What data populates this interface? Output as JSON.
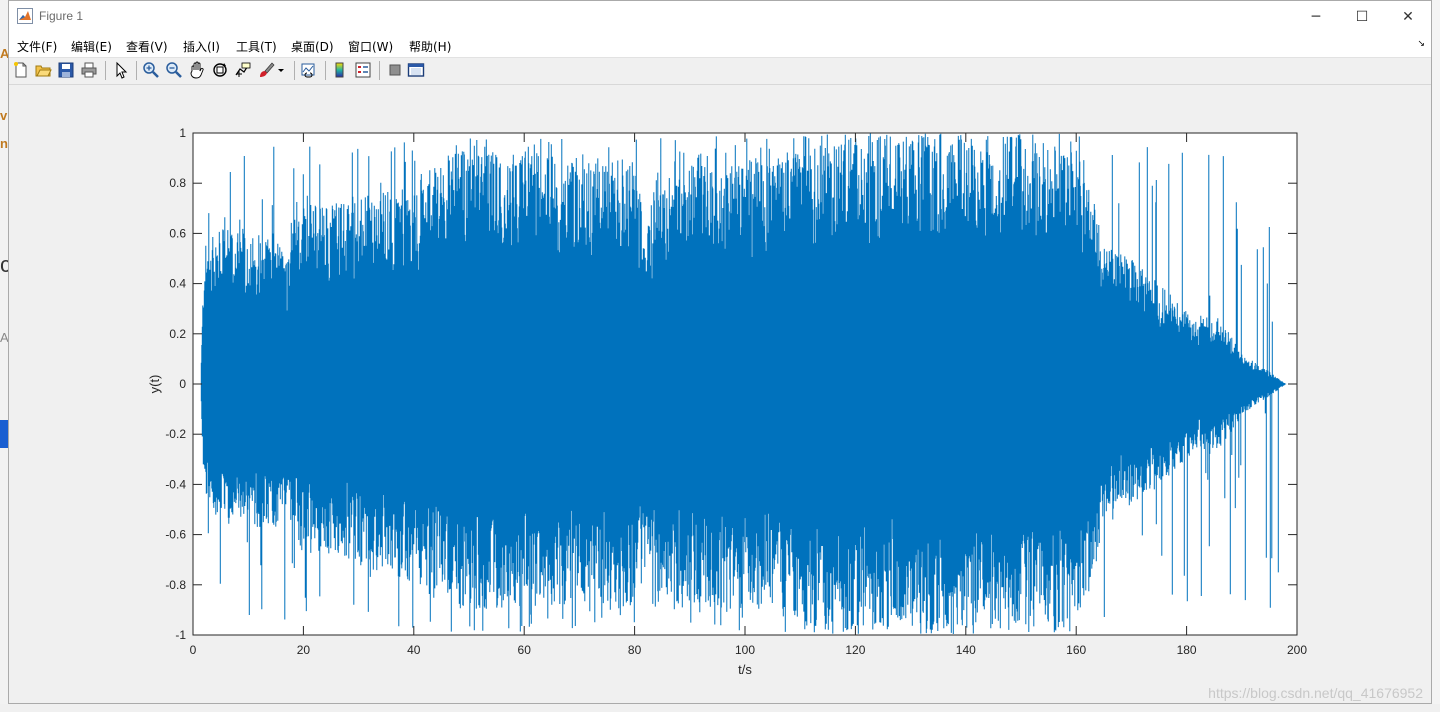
{
  "window": {
    "title": "Figure 1",
    "controls": {
      "minimize": "─",
      "maximize": "☐",
      "close": "✕"
    }
  },
  "menubar": {
    "items": [
      "文件(F)",
      "编辑(E)",
      "查看(V)",
      "插入(I)",
      "工具(T)",
      "桌面(D)",
      "窗口(W)",
      "帮助(H)"
    ]
  },
  "toolbar": {
    "tools": [
      "new-figure-icon",
      "open-file-icon",
      "save-icon",
      "print-icon",
      "pointer-icon",
      "zoom-in-icon",
      "zoom-out-icon",
      "pan-hand-icon",
      "rotate-3d-icon",
      "data-cursor-icon",
      "brush-icon",
      "link-plot-icon",
      "colorbar-icon",
      "legend-icon",
      "hide-plot-tools-icon",
      "show-plot-tools-icon"
    ]
  },
  "colors": {
    "line": "#0072bd",
    "axes_bg": "#ffffff",
    "figure_bg": "#f0f0f0"
  },
  "chart_data": {
    "type": "line",
    "xlabel": "t/s",
    "ylabel": "y(t)",
    "xlim": [
      0,
      200
    ],
    "ylim": [
      -1,
      1
    ],
    "xticks": [
      "0",
      "20",
      "40",
      "60",
      "80",
      "100",
      "120",
      "140",
      "160",
      "180",
      "200"
    ],
    "yticks": [
      "1",
      "0.8",
      "0.6",
      "0.4",
      "0.2",
      "0",
      "-0.2",
      "-0.4",
      "-0.6",
      "-0.8",
      "-1"
    ],
    "series": [
      {
        "envelope_t": [
          1.5,
          2,
          5,
          10,
          15,
          17,
          18,
          20,
          30,
          40,
          43,
          48,
          60,
          70,
          80,
          82,
          84,
          90,
          100,
          108,
          110,
          115,
          130,
          150,
          160,
          163,
          165,
          170,
          175,
          180,
          182,
          185,
          188,
          190,
          195,
          198
        ],
        "envelope_upper": [
          0.1,
          0.55,
          0.62,
          0.62,
          0.6,
          0.5,
          0.7,
          0.72,
          0.74,
          0.8,
          0.85,
          0.92,
          0.93,
          0.9,
          0.9,
          0.6,
          0.85,
          0.88,
          0.9,
          0.9,
          0.98,
          0.98,
          0.98,
          0.98,
          0.97,
          0.8,
          0.55,
          0.5,
          0.4,
          0.3,
          0.25,
          0.28,
          0.2,
          0.12,
          0.05,
          0.0
        ],
        "envelope_lower": [
          -0.1,
          -0.45,
          -0.55,
          -0.58,
          -0.58,
          -0.5,
          -0.6,
          -0.68,
          -0.72,
          -0.8,
          -0.85,
          -0.9,
          -0.9,
          -0.88,
          -0.9,
          -0.6,
          -0.85,
          -0.88,
          -0.9,
          -0.9,
          -0.97,
          -0.97,
          -0.97,
          -0.97,
          -0.96,
          -0.8,
          -0.55,
          -0.48,
          -0.4,
          -0.3,
          -0.25,
          -0.28,
          -0.2,
          -0.12,
          -0.05,
          0.0
        ]
      }
    ]
  },
  "watermark": "https://blog.csdn.net/qq_41676952"
}
